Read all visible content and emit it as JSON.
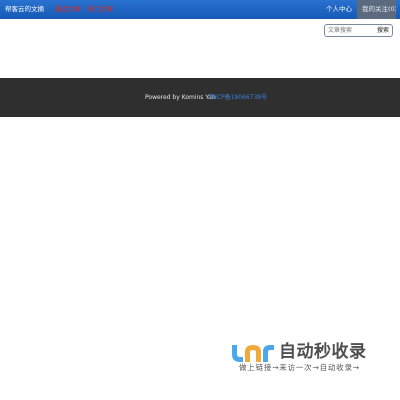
{
  "header": {
    "brand": "帮客云的文摘",
    "nav": [
      "最近文章",
      "热门文章"
    ],
    "user_center": "个人中心",
    "follow": "我的关注(0)"
  },
  "search": {
    "placeholder": "文章搜索",
    "button": "搜索"
  },
  "footer": {
    "powered": "Powered by Komins Yan",
    "icp": "粤ICP备19066738号"
  },
  "watermark": {
    "title": "自动秒收录",
    "subtitle": "做上链接→来访一次→自动收录→"
  },
  "colors": {
    "topbar": "#1b63c0",
    "nav_link": "#e02a20",
    "footer_bg": "#2f2f2f",
    "icp_link": "#3d7fd6"
  }
}
